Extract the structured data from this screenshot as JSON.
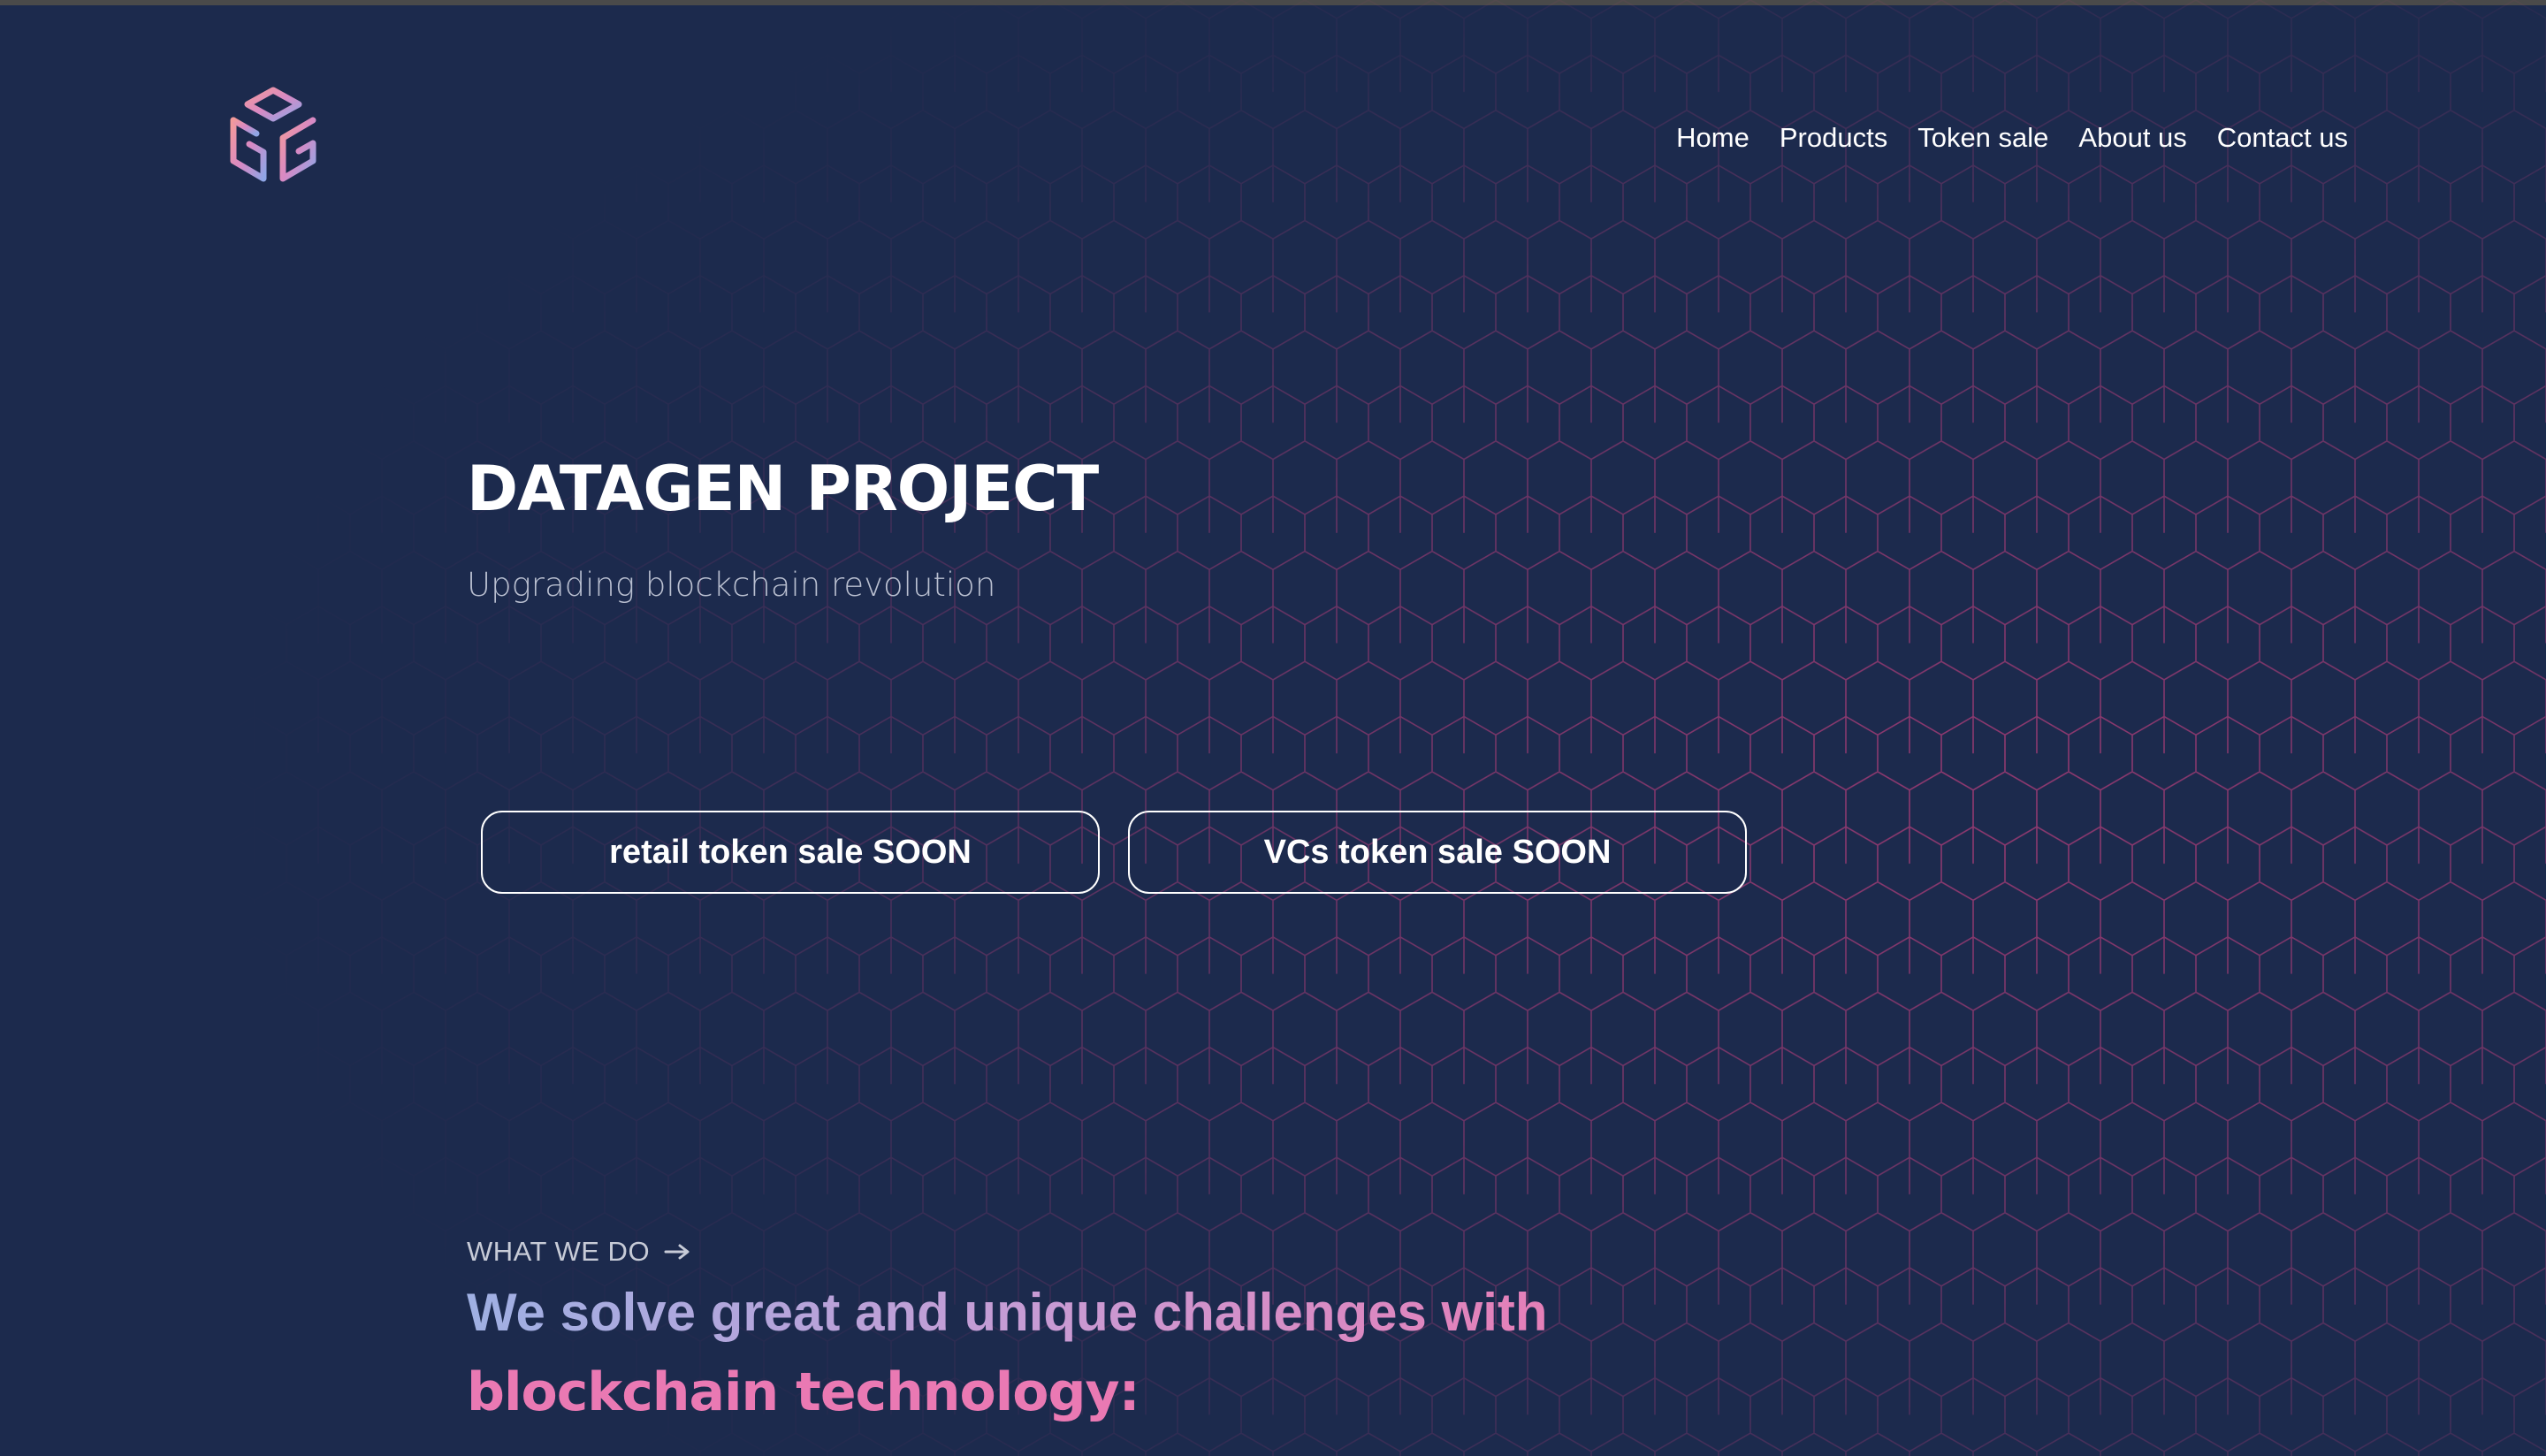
{
  "nav": {
    "items": [
      {
        "label": "Home"
      },
      {
        "label": "Products"
      },
      {
        "label": "Token sale"
      },
      {
        "label": "About us"
      },
      {
        "label": "Contact us"
      }
    ]
  },
  "hero": {
    "title": "DATAGEN PROJECT",
    "subtitle": "Upgrading blockchain revolution",
    "buttons": [
      {
        "label": "retail token sale SOON"
      },
      {
        "label": "VCs token sale SOON"
      }
    ]
  },
  "section": {
    "eyebrow": "WHAT WE DO",
    "heading_line1": "We solve great and unique challenges with",
    "heading_line2": "blockchain technology:"
  },
  "colors": {
    "background": "#1c2a4d",
    "hex_line": "#c2407f",
    "accent_pink": "#ea79b3",
    "accent_blue": "#9fb0e3"
  },
  "icons": {
    "logo": "datagen-cube-logo",
    "eyebrow_arrow": "arrow-right-icon"
  }
}
